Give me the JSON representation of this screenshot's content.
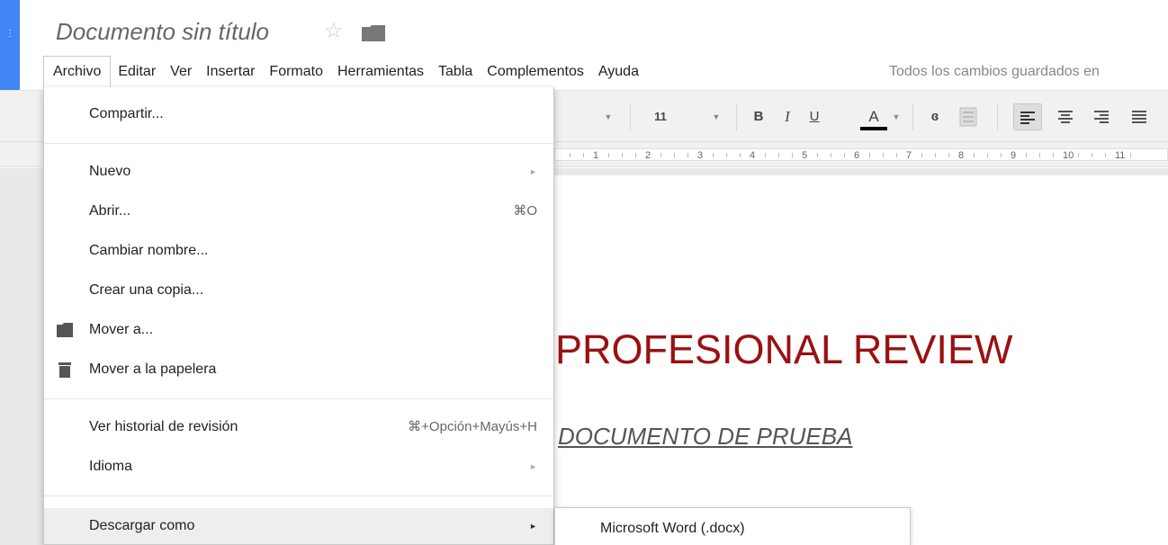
{
  "document": {
    "title": "Documento sin título",
    "star_icon": "star-icon",
    "folder_icon": "folder-icon"
  },
  "menubar": {
    "items": [
      "Archivo",
      "Editar",
      "Ver",
      "Insertar",
      "Formato",
      "Herramientas",
      "Tabla",
      "Complementos",
      "Ayuda"
    ],
    "active": "Archivo",
    "save_status": "Todos los cambios guardados en"
  },
  "toolbar": {
    "font_size": "11",
    "bold": "B",
    "italic": "I",
    "underline": "U",
    "text_color": "A",
    "link_icon": "link-icon",
    "comment_icon": "comment-icon",
    "align_icons": [
      "align-left-icon",
      "align-center-icon",
      "align-right-icon",
      "align-justify-icon"
    ]
  },
  "ruler": {
    "numbers": [
      "1",
      "2",
      "3",
      "4",
      "5",
      "6",
      "7",
      "8",
      "9",
      "10",
      "11"
    ]
  },
  "file_menu": {
    "share": "Compartir...",
    "new": "Nuevo",
    "open": "Abrir...",
    "open_shortcut": "⌘O",
    "rename": "Cambiar nombre...",
    "copy": "Crear una copia...",
    "move": "Mover a...",
    "trash": "Mover a la papelera",
    "history": "Ver historial de revisión",
    "history_shortcut": "⌘+Opción+Mayús+H",
    "language": "Idioma",
    "download": "Descargar como",
    "arrow": "►"
  },
  "download_submenu": {
    "items": [
      "Microsoft Word (.docx)"
    ]
  },
  "page": {
    "heading": "PROFESIONAL REVIEW",
    "subheading": "DOCUMENTO DE PRUEBA"
  },
  "colors": {
    "app_blue": "#4285f4",
    "heading_red": "#9a1111",
    "toolbar_bg": "#f1f1f1"
  }
}
